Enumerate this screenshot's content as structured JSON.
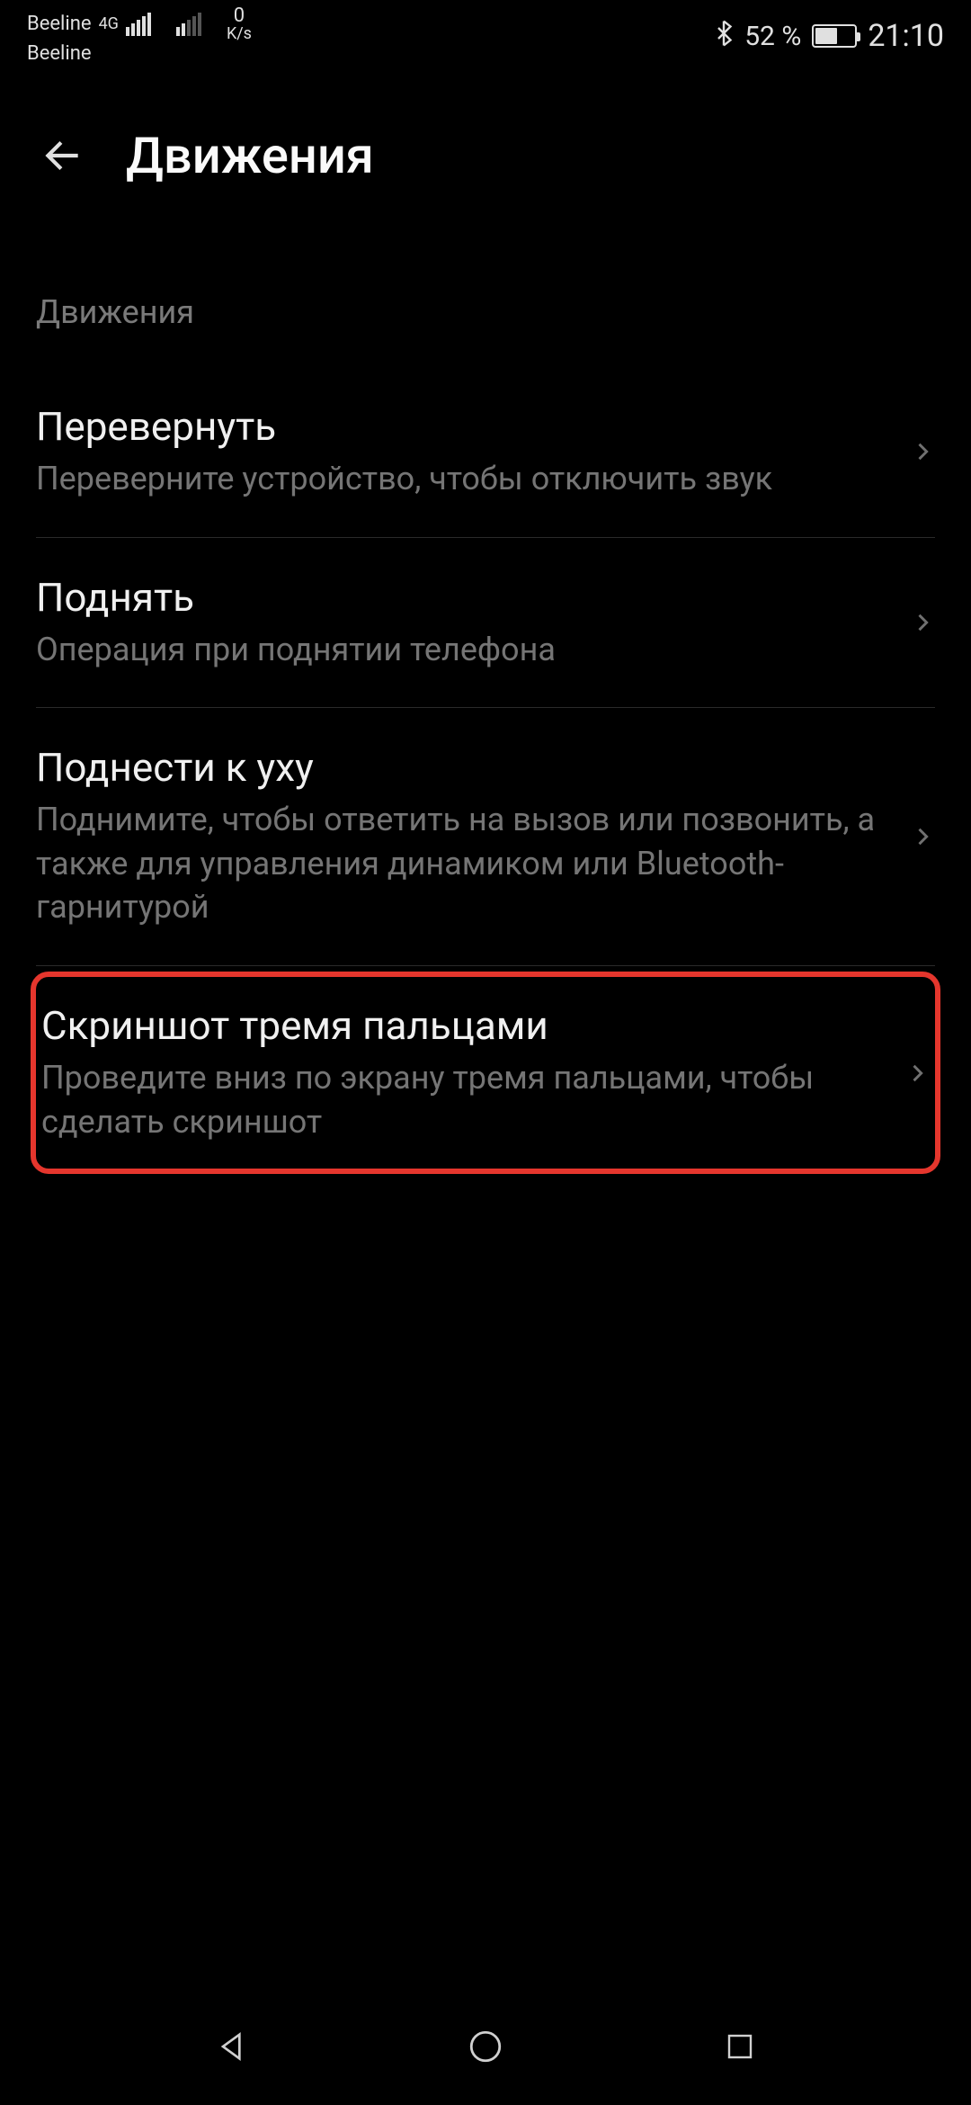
{
  "status": {
    "carrier1": "Beeline",
    "carrier2": "Beeline",
    "network_badge": "4G",
    "data_value": "0",
    "data_unit": "K/s",
    "battery_percent": "52 %",
    "time": "21:10"
  },
  "header": {
    "title": "Движения"
  },
  "section": {
    "label": "Движения"
  },
  "items": [
    {
      "title": "Перевернуть",
      "subtitle": "Переверните устройство, чтобы отключить звук",
      "highlighted": false
    },
    {
      "title": "Поднять",
      "subtitle": "Операция при поднятии телефона",
      "highlighted": false
    },
    {
      "title": "Поднести к уху",
      "subtitle": "Поднимите, чтобы ответить на вызов или позвонить, а также для управления динамиком или Bluetooth-гарнитурой",
      "highlighted": false
    },
    {
      "title": "Скриншот тремя пальцами",
      "subtitle": "Проведите вниз по экрану тремя пальцами, чтобы сделать скриншот",
      "highlighted": true
    }
  ]
}
